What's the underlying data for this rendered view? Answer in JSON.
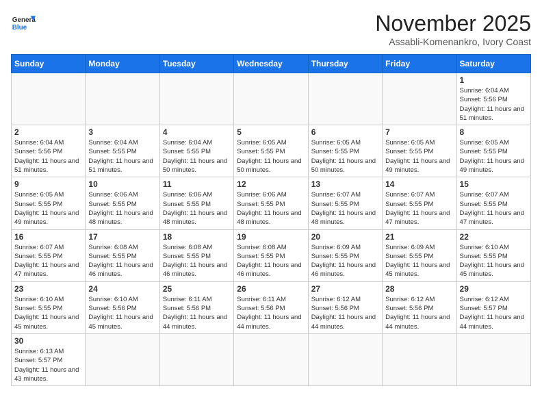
{
  "header": {
    "logo_general": "General",
    "logo_blue": "Blue",
    "month_title": "November 2025",
    "location": "Assabli-Komenankro, Ivory Coast"
  },
  "weekdays": [
    "Sunday",
    "Monday",
    "Tuesday",
    "Wednesday",
    "Thursday",
    "Friday",
    "Saturday"
  ],
  "weeks": [
    [
      {
        "day": "",
        "info": ""
      },
      {
        "day": "",
        "info": ""
      },
      {
        "day": "",
        "info": ""
      },
      {
        "day": "",
        "info": ""
      },
      {
        "day": "",
        "info": ""
      },
      {
        "day": "",
        "info": ""
      },
      {
        "day": "1",
        "info": "Sunrise: 6:04 AM\nSunset: 5:56 PM\nDaylight: 11 hours and 51 minutes."
      }
    ],
    [
      {
        "day": "2",
        "info": "Sunrise: 6:04 AM\nSunset: 5:56 PM\nDaylight: 11 hours and 51 minutes."
      },
      {
        "day": "3",
        "info": "Sunrise: 6:04 AM\nSunset: 5:55 PM\nDaylight: 11 hours and 51 minutes."
      },
      {
        "day": "4",
        "info": "Sunrise: 6:04 AM\nSunset: 5:55 PM\nDaylight: 11 hours and 50 minutes."
      },
      {
        "day": "5",
        "info": "Sunrise: 6:05 AM\nSunset: 5:55 PM\nDaylight: 11 hours and 50 minutes."
      },
      {
        "day": "6",
        "info": "Sunrise: 6:05 AM\nSunset: 5:55 PM\nDaylight: 11 hours and 50 minutes."
      },
      {
        "day": "7",
        "info": "Sunrise: 6:05 AM\nSunset: 5:55 PM\nDaylight: 11 hours and 49 minutes."
      },
      {
        "day": "8",
        "info": "Sunrise: 6:05 AM\nSunset: 5:55 PM\nDaylight: 11 hours and 49 minutes."
      }
    ],
    [
      {
        "day": "9",
        "info": "Sunrise: 6:05 AM\nSunset: 5:55 PM\nDaylight: 11 hours and 49 minutes."
      },
      {
        "day": "10",
        "info": "Sunrise: 6:06 AM\nSunset: 5:55 PM\nDaylight: 11 hours and 48 minutes."
      },
      {
        "day": "11",
        "info": "Sunrise: 6:06 AM\nSunset: 5:55 PM\nDaylight: 11 hours and 48 minutes."
      },
      {
        "day": "12",
        "info": "Sunrise: 6:06 AM\nSunset: 5:55 PM\nDaylight: 11 hours and 48 minutes."
      },
      {
        "day": "13",
        "info": "Sunrise: 6:07 AM\nSunset: 5:55 PM\nDaylight: 11 hours and 48 minutes."
      },
      {
        "day": "14",
        "info": "Sunrise: 6:07 AM\nSunset: 5:55 PM\nDaylight: 11 hours and 47 minutes."
      },
      {
        "day": "15",
        "info": "Sunrise: 6:07 AM\nSunset: 5:55 PM\nDaylight: 11 hours and 47 minutes."
      }
    ],
    [
      {
        "day": "16",
        "info": "Sunrise: 6:07 AM\nSunset: 5:55 PM\nDaylight: 11 hours and 47 minutes."
      },
      {
        "day": "17",
        "info": "Sunrise: 6:08 AM\nSunset: 5:55 PM\nDaylight: 11 hours and 46 minutes."
      },
      {
        "day": "18",
        "info": "Sunrise: 6:08 AM\nSunset: 5:55 PM\nDaylight: 11 hours and 46 minutes."
      },
      {
        "day": "19",
        "info": "Sunrise: 6:08 AM\nSunset: 5:55 PM\nDaylight: 11 hours and 46 minutes."
      },
      {
        "day": "20",
        "info": "Sunrise: 6:09 AM\nSunset: 5:55 PM\nDaylight: 11 hours and 46 minutes."
      },
      {
        "day": "21",
        "info": "Sunrise: 6:09 AM\nSunset: 5:55 PM\nDaylight: 11 hours and 45 minutes."
      },
      {
        "day": "22",
        "info": "Sunrise: 6:10 AM\nSunset: 5:55 PM\nDaylight: 11 hours and 45 minutes."
      }
    ],
    [
      {
        "day": "23",
        "info": "Sunrise: 6:10 AM\nSunset: 5:55 PM\nDaylight: 11 hours and 45 minutes."
      },
      {
        "day": "24",
        "info": "Sunrise: 6:10 AM\nSunset: 5:56 PM\nDaylight: 11 hours and 45 minutes."
      },
      {
        "day": "25",
        "info": "Sunrise: 6:11 AM\nSunset: 5:56 PM\nDaylight: 11 hours and 44 minutes."
      },
      {
        "day": "26",
        "info": "Sunrise: 6:11 AM\nSunset: 5:56 PM\nDaylight: 11 hours and 44 minutes."
      },
      {
        "day": "27",
        "info": "Sunrise: 6:12 AM\nSunset: 5:56 PM\nDaylight: 11 hours and 44 minutes."
      },
      {
        "day": "28",
        "info": "Sunrise: 6:12 AM\nSunset: 5:56 PM\nDaylight: 11 hours and 44 minutes."
      },
      {
        "day": "29",
        "info": "Sunrise: 6:12 AM\nSunset: 5:57 PM\nDaylight: 11 hours and 44 minutes."
      }
    ],
    [
      {
        "day": "30",
        "info": "Sunrise: 6:13 AM\nSunset: 5:57 PM\nDaylight: 11 hours and 43 minutes."
      },
      {
        "day": "",
        "info": ""
      },
      {
        "day": "",
        "info": ""
      },
      {
        "day": "",
        "info": ""
      },
      {
        "day": "",
        "info": ""
      },
      {
        "day": "",
        "info": ""
      },
      {
        "day": "",
        "info": ""
      }
    ]
  ]
}
